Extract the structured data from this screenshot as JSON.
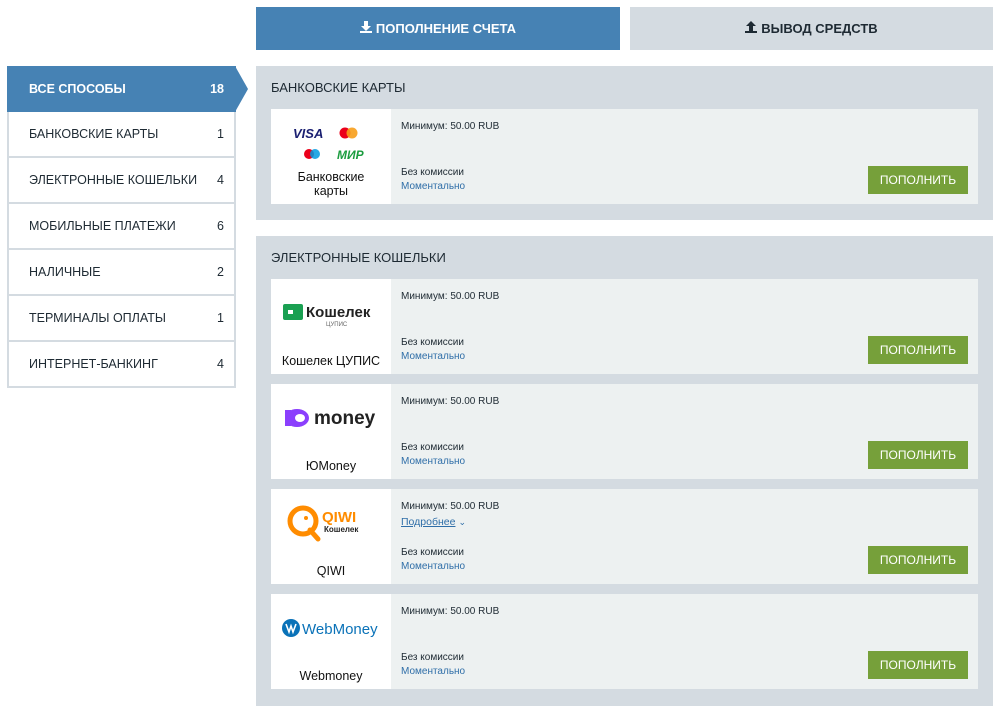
{
  "tabs": {
    "deposit": {
      "label": "ПОПОЛНЕНИЕ СЧЕТА",
      "icon": "download-icon"
    },
    "withdraw": {
      "label": "ВЫВОД СРЕДСТВ",
      "icon": "upload-icon"
    }
  },
  "sidebar": {
    "items": [
      {
        "label": "ВСЕ СПОСОБЫ",
        "count": "18",
        "active": true
      },
      {
        "label": "БАНКОВСКИЕ КАРТЫ",
        "count": "1"
      },
      {
        "label": "ЭЛЕКТРОННЫЕ КОШЕЛЬКИ",
        "count": "4"
      },
      {
        "label": "МОБИЛЬНЫЕ ПЛАТЕЖИ",
        "count": "6"
      },
      {
        "label": "НАЛИЧНЫЕ",
        "count": "2"
      },
      {
        "label": "ТЕРМИНАЛЫ ОПЛАТЫ",
        "count": "1"
      },
      {
        "label": "ИНТЕРНЕТ-БАНКИНГ",
        "count": "4"
      }
    ]
  },
  "sections": {
    "bank": {
      "title": "БАНКОВСКИЕ КАРТЫ",
      "cards": [
        {
          "name": "Банковские карты",
          "logo_text": {
            "visa": "VISA",
            "mir": "МИР"
          },
          "min": "Минимум: 50.00 RUB",
          "fee": "Без комиссии",
          "speed": "Моментально",
          "button": "ПОПОЛНИТЬ"
        }
      ]
    },
    "wallets": {
      "title": "ЭЛЕКТРОННЫЕ КОШЕЛЬКИ",
      "cards": [
        {
          "name": "Кошелек ЦУПИС",
          "logo_text": {
            "main": "Кошелек",
            "sub": "ЦУПИС"
          },
          "min": "Минимум: 50.00 RUB",
          "fee": "Без комиссии",
          "speed": "Моментально",
          "button": "ПОПОЛНИТЬ"
        },
        {
          "name": "ЮMoney",
          "logo_text": {
            "main": "money"
          },
          "min": "Минимум: 50.00 RUB",
          "fee": "Без комиссии",
          "speed": "Моментально",
          "button": "ПОПОЛНИТЬ"
        },
        {
          "name": "QIWI",
          "logo_text": {
            "main": "QIWI",
            "sub": "Кошелек"
          },
          "min": "Минимум: 50.00 RUB",
          "more": "Подробнее",
          "fee": "Без комиссии",
          "speed": "Моментально",
          "button": "ПОПОЛНИТЬ"
        },
        {
          "name": "Webmoney",
          "logo_text": {
            "main": "WebMoney"
          },
          "min": "Минимум: 50.00 RUB",
          "fee": "Без комиссии",
          "speed": "Моментально",
          "button": "ПОПОЛНИТЬ"
        }
      ]
    }
  },
  "colors": {
    "accent": "#4682b4",
    "button": "#76a03a",
    "panel": "#d4dbe1"
  }
}
